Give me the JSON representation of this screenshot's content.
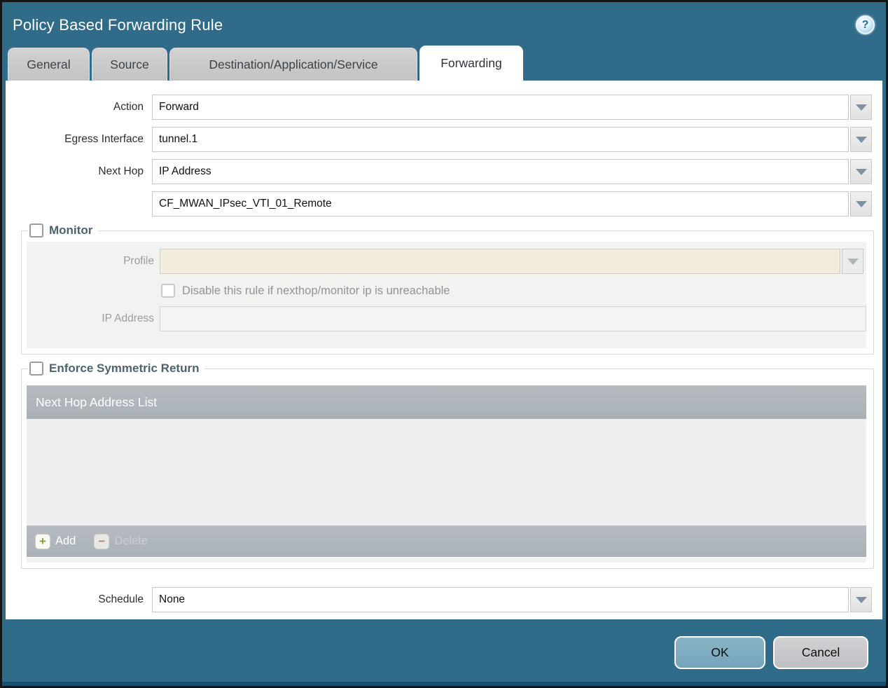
{
  "dialog": {
    "title": "Policy Based Forwarding Rule"
  },
  "icons": {
    "help": "?",
    "add": "+",
    "delete": "−"
  },
  "tabs": [
    {
      "label": "General",
      "active": false
    },
    {
      "label": "Source",
      "active": false
    },
    {
      "label": "Destination/Application/Service",
      "active": false
    },
    {
      "label": "Forwarding",
      "active": true
    }
  ],
  "form": {
    "action": {
      "label": "Action",
      "value": "Forward"
    },
    "egress_interface": {
      "label": "Egress Interface",
      "value": "tunnel.1"
    },
    "next_hop": {
      "label": "Next Hop",
      "value": "IP Address"
    },
    "next_hop_address": {
      "value": "CF_MWAN_IPsec_VTI_01_Remote"
    },
    "monitor": {
      "legend": "Monitor",
      "checked": false,
      "profile_label": "Profile",
      "profile_value": "",
      "disable_rule_label": "Disable this rule if nexthop/monitor ip is unreachable",
      "disable_rule_checked": false,
      "ip_address_label": "IP Address",
      "ip_address_value": ""
    },
    "enforce_symmetric_return": {
      "legend": "Enforce Symmetric Return",
      "checked": false,
      "table_header": "Next Hop Address List",
      "rows": [],
      "add_label": "Add",
      "delete_label": "Delete",
      "delete_enabled": false
    },
    "schedule": {
      "label": "Schedule",
      "value": "None"
    }
  },
  "footer": {
    "ok_label": "OK",
    "cancel_label": "Cancel"
  },
  "colors": {
    "accent_teal": "#306b8a",
    "bottom_strip": "#1c4f6e",
    "table_gray": "#aeb5ba",
    "panel_gray": "#f2f3f1",
    "profile_beige": "#f1ecdc",
    "ok_button": "#7dabc0",
    "cancel_button": "#c9c9cd",
    "legend_text": "#4e6370",
    "add_green": "#86a03c",
    "delete_red": "#b5826f"
  }
}
